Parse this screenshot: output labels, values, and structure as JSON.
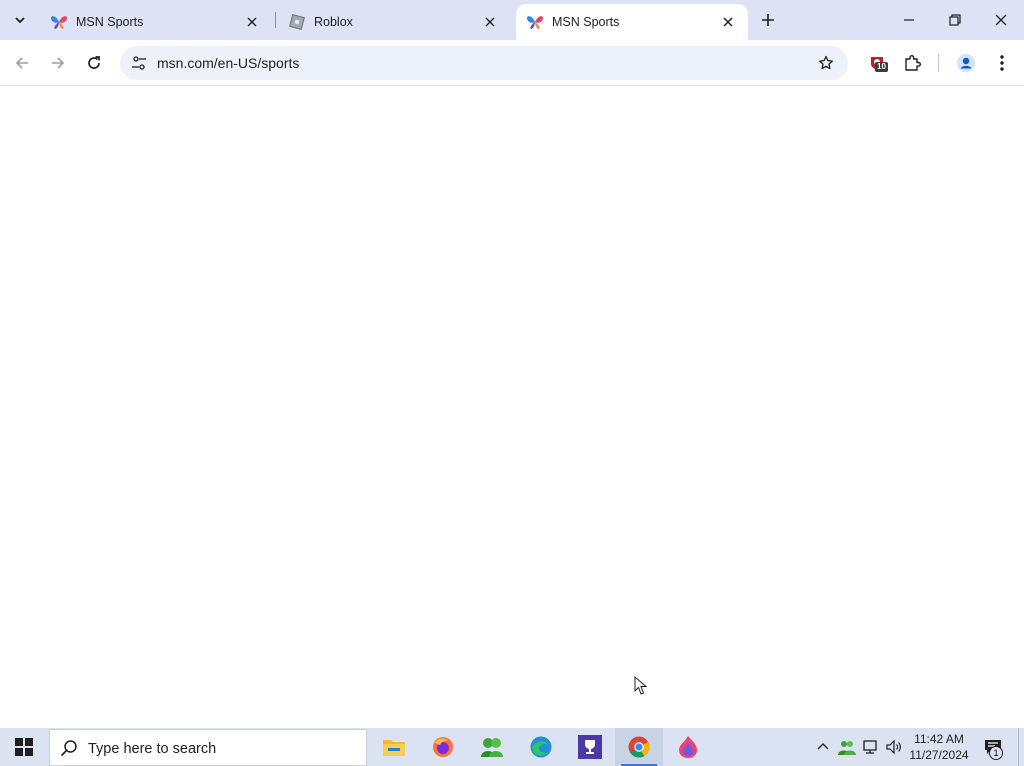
{
  "browser": {
    "tabs": [
      {
        "title": "MSN Sports",
        "favicon": "msn-butterfly-icon",
        "active": false
      },
      {
        "title": "Roblox",
        "favicon": "roblox-icon",
        "active": false
      },
      {
        "title": "MSN Sports",
        "favicon": "msn-butterfly-icon",
        "active": true
      }
    ],
    "address_bar": {
      "url": "msn.com/en-US/sports"
    },
    "extension_badge": "10"
  },
  "taskbar": {
    "search_placeholder": "Type here to search",
    "apps": [
      "file-explorer-icon",
      "firefox-icon",
      "green-app-icon",
      "edge-icon",
      "trophy-app-icon",
      "chrome-icon",
      "flame-app-icon"
    ],
    "clock": {
      "time": "11:42 AM",
      "date": "11/27/2024"
    },
    "notification_count": "1"
  },
  "colors": {
    "tabstrip_bg": "#dde3f4",
    "omnibox_bg": "#edf1f9",
    "taskbar_bg": "#dbe3f2",
    "accent": "#3b78d6"
  }
}
